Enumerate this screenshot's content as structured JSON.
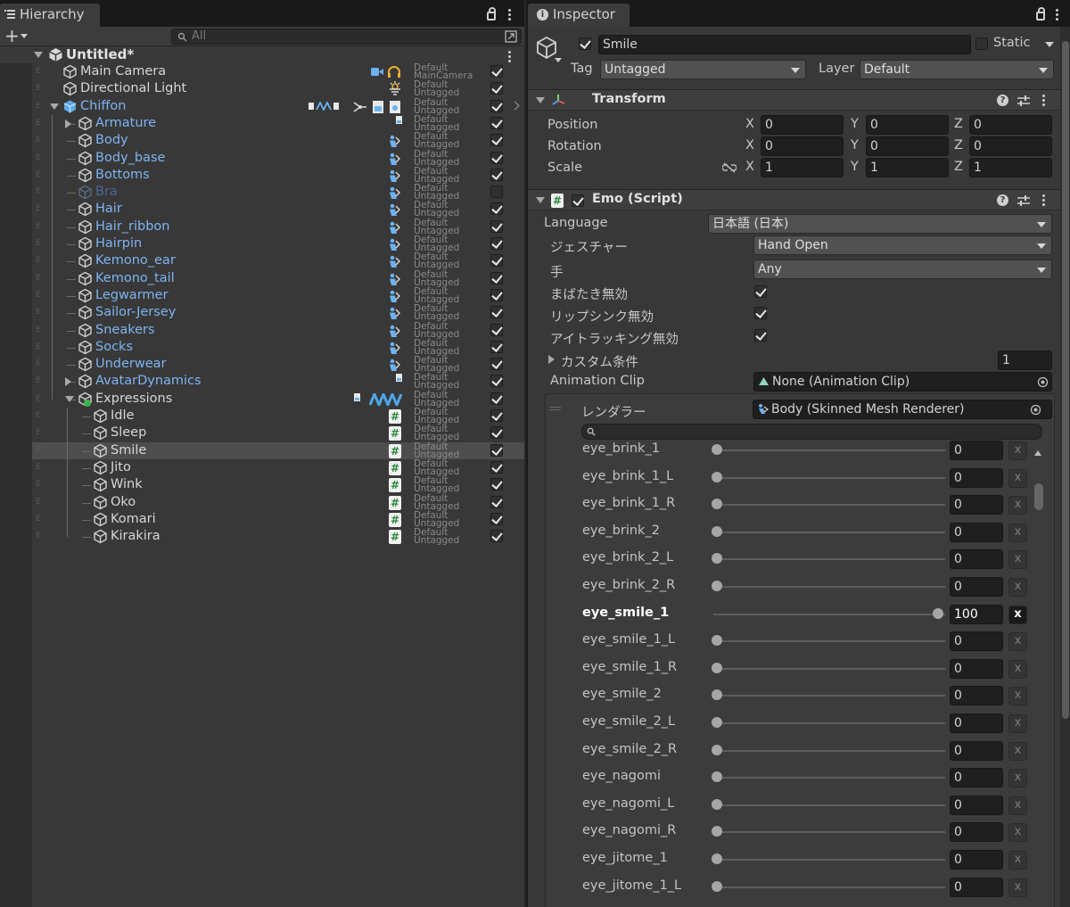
{
  "hierarchy": {
    "tab_label": "Hierarchy",
    "search_placeholder": "All",
    "scene_name": "Untitled*",
    "items": [
      {
        "name": "Main Camera",
        "tag1": "Default",
        "tag2": "MainCamera",
        "checked": true
      },
      {
        "name": "Directional Light",
        "tag1": "Default",
        "tag2": "Untagged",
        "checked": true
      },
      {
        "name": "Chiffon",
        "tag1": "Default",
        "tag2": "Untagged",
        "checked": true
      },
      {
        "name": "Armature",
        "tag1": "Default",
        "tag2": "Untagged",
        "checked": true
      },
      {
        "name": "Body",
        "tag1": "Default",
        "tag2": "Untagged",
        "checked": true
      },
      {
        "name": "Body_base",
        "tag1": "Default",
        "tag2": "Untagged",
        "checked": true
      },
      {
        "name": "Bottoms",
        "tag1": "Default",
        "tag2": "Untagged",
        "checked": true
      },
      {
        "name": "Bra",
        "tag1": "Default",
        "tag2": "Untagged",
        "checked": false
      },
      {
        "name": "Hair",
        "tag1": "Default",
        "tag2": "Untagged",
        "checked": true
      },
      {
        "name": "Hair_ribbon",
        "tag1": "Default",
        "tag2": "Untagged",
        "checked": true
      },
      {
        "name": "Hairpin",
        "tag1": "Default",
        "tag2": "Untagged",
        "checked": true
      },
      {
        "name": "Kemono_ear",
        "tag1": "Default",
        "tag2": "Untagged",
        "checked": true
      },
      {
        "name": "Kemono_tail",
        "tag1": "Default",
        "tag2": "Untagged",
        "checked": true
      },
      {
        "name": "Legwarmer",
        "tag1": "Default",
        "tag2": "Untagged",
        "checked": true
      },
      {
        "name": "Sailor-Jersey",
        "tag1": "Default",
        "tag2": "Untagged",
        "checked": true
      },
      {
        "name": "Sneakers",
        "tag1": "Default",
        "tag2": "Untagged",
        "checked": true
      },
      {
        "name": "Socks",
        "tag1": "Default",
        "tag2": "Untagged",
        "checked": true
      },
      {
        "name": "Underwear",
        "tag1": "Default",
        "tag2": "Untagged",
        "checked": true
      },
      {
        "name": "AvatarDynamics",
        "tag1": "Default",
        "tag2": "Untagged",
        "checked": true
      },
      {
        "name": "Expressions",
        "tag1": "Default",
        "tag2": "Untagged",
        "checked": true
      },
      {
        "name": "Idle",
        "tag1": "Default",
        "tag2": "Untagged",
        "checked": true
      },
      {
        "name": "Sleep",
        "tag1": "Default",
        "tag2": "Untagged",
        "checked": true
      },
      {
        "name": "Smile",
        "tag1": "Default",
        "tag2": "Untagged",
        "checked": true
      },
      {
        "name": "Jito",
        "tag1": "Default",
        "tag2": "Untagged",
        "checked": true
      },
      {
        "name": "Wink",
        "tag1": "Default",
        "tag2": "Untagged",
        "checked": true
      },
      {
        "name": "Oko",
        "tag1": "Default",
        "tag2": "Untagged",
        "checked": true
      },
      {
        "name": "Komari",
        "tag1": "Default",
        "tag2": "Untagged",
        "checked": true
      },
      {
        "name": "Kirakira",
        "tag1": "Default",
        "tag2": "Untagged",
        "checked": true
      }
    ]
  },
  "inspector": {
    "tab_label": "Inspector",
    "object_name": "Smile",
    "static_label": "Static",
    "tag_label": "Tag",
    "tag_value": "Untagged",
    "layer_label": "Layer",
    "layer_value": "Default",
    "transform": {
      "title": "Transform",
      "position_label": "Position",
      "rotation_label": "Rotation",
      "scale_label": "Scale",
      "axis_x": "X",
      "axis_y": "Y",
      "axis_z": "Z",
      "position": [
        "0",
        "0",
        "0"
      ],
      "rotation": [
        "0",
        "0",
        "0"
      ],
      "scale": [
        "1",
        "1",
        "1"
      ]
    },
    "emo": {
      "title": "Emo (Script)",
      "language_label": "Language",
      "language_value": "日本語 (日本)",
      "gesture_label": "ジェスチャー",
      "gesture_value": "Hand Open",
      "hand_label": "手",
      "hand_value": "Any",
      "blink_label": "まばたき無効",
      "lipsync_label": "リップシンク無効",
      "eyetrack_label": "アイトラッキング無効",
      "custom_label": "カスタム条件",
      "custom_value": "1",
      "anim_label": "Animation Clip",
      "anim_value": "None (Animation Clip)",
      "renderer_label": "レンダラー",
      "renderer_value": "Body (Skinned Mesh Renderer)",
      "x_label": "x",
      "blendshapes": [
        {
          "name": "eye_brink_1",
          "value": "0",
          "frac": 0
        },
        {
          "name": "eye_brink_1_L",
          "value": "0",
          "frac": 0
        },
        {
          "name": "eye_brink_1_R",
          "value": "0",
          "frac": 0
        },
        {
          "name": "eye_brink_2",
          "value": "0",
          "frac": 0
        },
        {
          "name": "eye_brink_2_L",
          "value": "0",
          "frac": 0
        },
        {
          "name": "eye_brink_2_R",
          "value": "0",
          "frac": 0
        },
        {
          "name": "eye_smile_1",
          "value": "100",
          "frac": 1
        },
        {
          "name": "eye_smile_1_L",
          "value": "0",
          "frac": 0
        },
        {
          "name": "eye_smile_1_R",
          "value": "0",
          "frac": 0
        },
        {
          "name": "eye_smile_2",
          "value": "0",
          "frac": 0
        },
        {
          "name": "eye_smile_2_L",
          "value": "0",
          "frac": 0
        },
        {
          "name": "eye_smile_2_R",
          "value": "0",
          "frac": 0
        },
        {
          "name": "eye_nagomi",
          "value": "0",
          "frac": 0
        },
        {
          "name": "eye_nagomi_L",
          "value": "0",
          "frac": 0
        },
        {
          "name": "eye_nagomi_R",
          "value": "0",
          "frac": 0
        },
        {
          "name": "eye_jitome_1",
          "value": "0",
          "frac": 0
        },
        {
          "name": "eye_jitome_1_L",
          "value": "0",
          "frac": 0
        }
      ]
    }
  },
  "colors": {
    "selection_blue": "#7eb4f2",
    "panel_bg": "#383838",
    "active_text": "#ffffff"
  }
}
